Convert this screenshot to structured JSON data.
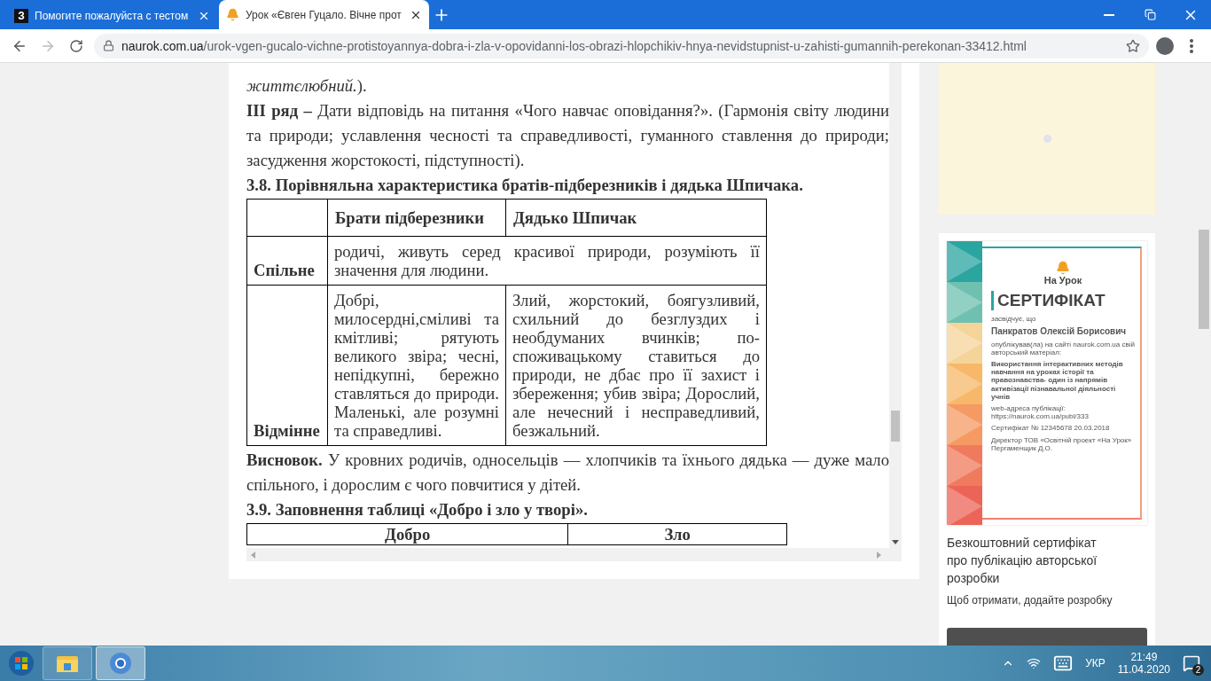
{
  "browser": {
    "tabs": [
      {
        "icon": "З",
        "title": "Помогите пожалуйста с тестом",
        "selected": false
      },
      {
        "title": "Урок «Євген Гуцало. Вічне прот",
        "selected": true
      }
    ],
    "url": {
      "domain": "naurok.com.ua",
      "path": "/urok-vgen-gucalo-vichne-protistoyannya-dobra-i-zla-v-opovidanni-los-obrazi-hlopchikiv-hnya-nevidstupnist-u-zahisti-gumannih-perekonan-33412.html"
    }
  },
  "article": [
    {
      "kind": "text",
      "text": "*життєлюбний.*)."
    },
    {
      "kind": "text",
      "text": "**III ряд –** Дати відповідь на питання «Чого навчає оповідання?». (Гармонія світу людини та природи; уславлення чесності  та справедливості, гуманного ставлення до природи; засудження жорстокості, підступності)."
    },
    {
      "kind": "heading",
      "text": "3.8. Порівняльна характеристика братів-підберезників і дядька Шпичака."
    },
    {
      "kind": "table",
      "columns": [
        "Брати підберезники",
        "Дядько Шпичак"
      ],
      "rows": [
        {
          "label": "Спільне",
          "cells": [
            {
              "text": "родичі, живуть серед красивої природи, розуміють її значення для людини.",
              "colspan": 2
            }
          ]
        },
        {
          "label": "Відмінне",
          "cells": [
            "Добрі, милосердні,сміливі та кмітливі; рятують великого звіра; чесні, непідкупні, бережно ставляться до природи. Маленькі, але розумні та справедливі.",
            "Злий, жорстокий, боягузливий, схильний до безглуздих і необдуманих вчинків; по-споживацькому ставиться до природи, не дбає про її захист і збереження; убив звіра; Дорослий, але нечесний і несправедливий, безжальний."
          ]
        }
      ]
    },
    {
      "kind": "text",
      "text": "**Висновок.** У кровних родичів, односельців — хлопчиків та їхнього дядька — дуже мало спільного, і дорослим є чого повчитися у дітей."
    },
    {
      "kind": "heading",
      "text": "3.9. Заповнення таблиці «Добро і зло у творі»."
    },
    {
      "kind": "table",
      "columns": [
        "Добро",
        "Зло"
      ]
    }
  ],
  "sidebar": {
    "certificate": {
      "brand": "На Урок",
      "title": "СЕРТИФІКАТ",
      "lines": [
        {
          "kind": "small",
          "text": "засвідчує, що"
        },
        {
          "kind": "name",
          "text": "Панкратов Олексій Борисович"
        },
        {
          "kind": "small",
          "text": "опублікував(ла) на сайті naurok.com.ua свій авторський матеріал:"
        },
        {
          "kind": "bold",
          "text": "Використання інтерактивних методів навчання на уроках історії та правознавства- один із напрямів активізації пізнавальної діяльності учнів"
        },
        {
          "kind": "small",
          "text": "web-адреса публікації: https://naurok.com.ua/publ/333"
        },
        {
          "kind": "small",
          "text": "Сертифікат № 12345678 20.03.2018"
        },
        {
          "kind": "tiny",
          "text": "Директор ТОВ «Освітній проект «На Урок» Пергаменщик Д.О."
        }
      ]
    },
    "caption": "Безкоштовний сертифікат про публікацію авторської розробки",
    "note": "Щоб отримати, додайте розробку"
  },
  "taskbar": {
    "apps": [
      {
        "kind": "folder",
        "selected": false
      },
      {
        "kind": "browser",
        "selected": true
      }
    ],
    "language": "УКР",
    "time": "21:49",
    "date": "11.04.2020",
    "notifications": "2"
  }
}
